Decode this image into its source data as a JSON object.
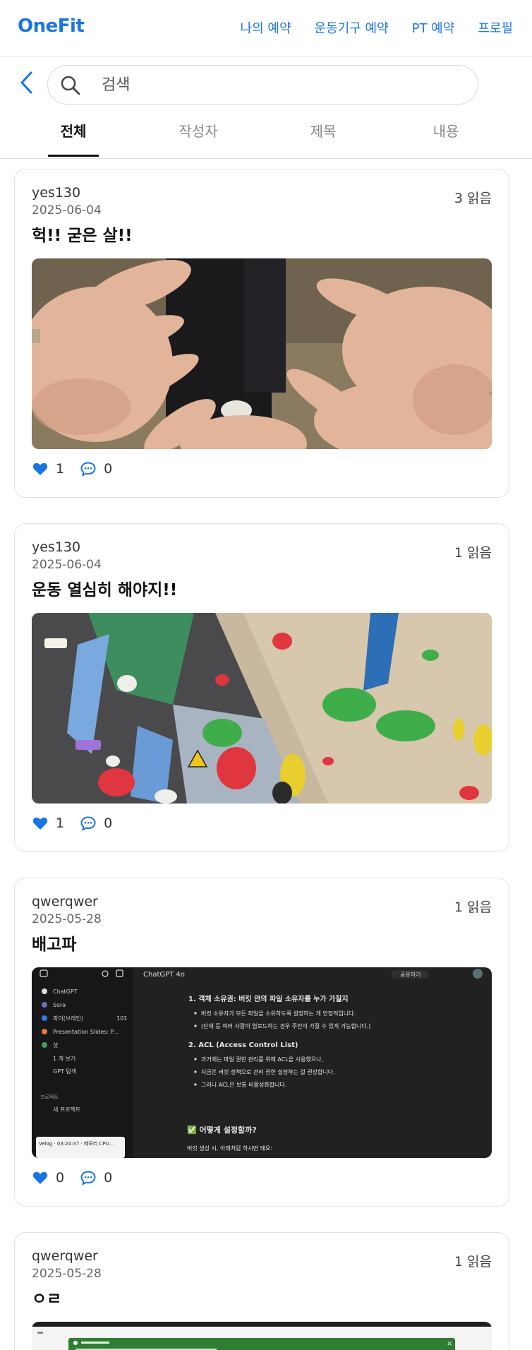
{
  "header": {
    "brand": "OneFit",
    "nav": [
      "나의 예약",
      "운동기구 예약",
      "PT 예약",
      "프로필"
    ]
  },
  "search": {
    "placeholder": "검색"
  },
  "tabs": [
    "전체",
    "작성자",
    "제목",
    "내용"
  ],
  "active_tab": "전체",
  "colors": {
    "accent": "#1b74e4",
    "like": "#1b74e4"
  },
  "posts": [
    {
      "author": "yes130",
      "date": "2025-06-04",
      "reads": "3 읽음",
      "title": "헉!! 굳은 살!!",
      "likes": "1",
      "comments": "0"
    },
    {
      "author": "yes130",
      "date": "2025-06-04",
      "reads": "1 읽음",
      "title": "운동 열심히 해야지!!",
      "likes": "1",
      "comments": "0"
    },
    {
      "author": "qwerqwer",
      "date": "2025-05-28",
      "reads": "1 읽음",
      "title": "배고파",
      "likes": "0",
      "comments": "0"
    },
    {
      "author": "qwerqwer",
      "date": "2025-05-28",
      "reads": "1 읽음",
      "title": "ㅇㄹ",
      "likes": "",
      "comments": ""
    }
  ],
  "screenshot_text": {
    "app_header": "ChatGPT 4o",
    "share": "공유하기",
    "sidebar": [
      "ChatGPT",
      "Sora",
      "파이(브레인)",
      "Presentation Slides: P...",
      "샷",
      "1 개 보기",
      "GPT 탐색",
      "프로젝트",
      "새 프로젝트"
    ],
    "sidebar_count": "101",
    "heading1": "1. 객체 소유권: 버킷 안의 파일 소유자를 누가 가질지",
    "bullets1": [
      "버킷 소유자가 모든 파일을 소유하도록 설정하는 게 안정적입니다.",
      "(단체 등 여러 사람이 업로드하는 경우 주인이 가질 수 있게 가능합니다.)"
    ],
    "heading2": "2. ACL (Access Control List)",
    "bullets2": [
      "과거에는 파일 권한 관리를 위해 ACL을 사용했으나,",
      "지금은 버킷 정책으로 관리 권한 설정하는 걸 권장합니다.",
      "그러니 ACL은 보통 비활성화합니다."
    ],
    "heading3": "✅ 어떻게 설정할까?",
    "tail": "버킷 생성 시, 아래처럼 하시면 돼요:",
    "bottom_tag": "Velog · 03:24:37 · 메모리 CPU..."
  }
}
